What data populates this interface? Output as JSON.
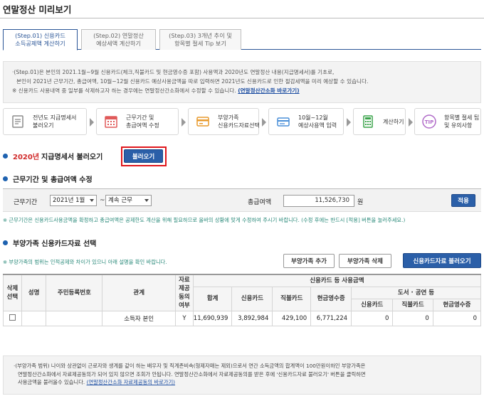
{
  "page_title": "연말정산 미리보기",
  "tabs": [
    {
      "line1": "(Step.01) 신용카드",
      "line2": "소득공제액 계산하기",
      "active": true
    },
    {
      "line1": "(Step.02) 연말정산",
      "line2": "예상세액 계산하기",
      "active": false
    },
    {
      "line1": "(Step.03) 3개년 추이 및",
      "line2": "항목별 절세 Tip 보기",
      "active": false
    }
  ],
  "info": {
    "line1": "·(Step.01)은 본인의 2021.1월~9월 신용카드(체크,직불카드 및 현금영수증 포함) 사용액과 2020년도 연말정산 내용(지급명세서)를 기초로,",
    "line2": "본인이 2021년 근무기간, 총급여액, 10월~12월 신용카드 예상사용금액을 따로 입력하면 2021년도 신용카드로 인한 절감세액을 미리 예상할 수 있습니다.",
    "line3": "※ 신용카드 사용내역 중 일부를 삭제하고자 하는 경우에는 연말정산간소화에서 수정할 수 있습니다.",
    "line3_link": "(연말정산간소화 바로가기)"
  },
  "steps": [
    {
      "line1": "전년도 지급명세서",
      "line2": "불러오기",
      "icon": "document-icon",
      "color": "#8c8c8c"
    },
    {
      "line1": "근무기간 및",
      "line2": "총급여액 수정",
      "icon": "calendar-icon",
      "color": "#e05a5a"
    },
    {
      "line1": "부양가족",
      "line2": "신용카드자료선택",
      "icon": "card-icon",
      "color": "#e89a2c"
    },
    {
      "line1": "10월~12월",
      "line2": "예상사용액 입력",
      "icon": "card-input-icon",
      "color": "#4a8fd8"
    },
    {
      "line1": "계산하기",
      "line2": "",
      "icon": "calculator-icon",
      "color": "#3aa34a"
    },
    {
      "line1": "항목별 절세 팁",
      "line2": "및 유의사항",
      "icon": "tip-icon",
      "color": "#b06ac8"
    }
  ],
  "section1": {
    "year": "2020년",
    "title": "지급명세서 불러오기",
    "button": "불러오기"
  },
  "section2": {
    "title": "근무기간 및 총급여액 수정",
    "period_label": "근무기간",
    "start_value": "2021년 1월",
    "separator": "~",
    "end_value": "계속 근무",
    "salary_label": "총급여액",
    "salary_value": "11,526,730",
    "unit": "원",
    "apply_button": "적용",
    "note": "※ 근무기간은 신용카드사용금액을 확정하고 총급여액은 공제한도 계산을 위해 필요하므로 올바의 상황에 맞게 수정하여 주시기 바랍니다. (수정 후에는 반드시 [적용] 버튼을 눌러주세요.)"
  },
  "section3": {
    "title": "부양가족 신용카드자료 선택",
    "note": "※ 부양가족의 범위는 인적공제와 차이가 있으니 아래 설명을 확인 바랍니다.",
    "add_button": "부양가족 추가",
    "delete_button": "부양가족 삭제",
    "load_button": "신용카드자료 불러오기"
  },
  "table": {
    "headers": {
      "select": "삭제\n선택",
      "name": "성명",
      "id": "주민등록번호",
      "relation": "관계",
      "consent": "자료\n제공\n동의\n여부",
      "usage_group": "신용카드 등 사용금액",
      "total": "합계",
      "credit": "신용카드",
      "debit": "직불카드",
      "cash": "현금영수증",
      "books_group": "도서 · 공연 등",
      "b_credit": "신용카드",
      "b_debit": "직불카드",
      "b_cash": "현금영수증"
    },
    "rows": [
      {
        "name": "",
        "id": "",
        "relation": "소득자 본인",
        "consent": "Y",
        "total": "11,690,939",
        "credit": "3,892,984",
        "debit": "429,100",
        "cash": "6,771,224",
        "b_credit": "0",
        "b_debit": "0",
        "b_cash": "0"
      }
    ]
  },
  "bottom": {
    "line1": "·(부양가족 범위) 나이와 상관없이 근로자와 생계를 같이 하는 배우자 및 직계존비속(형제자매는 제외)으로서 연간 소득금액의 합계액이 100만원이하인 부양가족은",
    "line2": "연말정산간소화에서 자료제공동의가 되어 있지 않으면 조회가 안됩니다. 연말정산간소화에서 자료제공동의를 받은 후에 '신용카드자료 불러오기' 버튼을 클릭하면",
    "line3": "사용금액을 불러올수 있습니다.",
    "link": "(연말정산간소화 자료제공동의 바로가기)"
  }
}
